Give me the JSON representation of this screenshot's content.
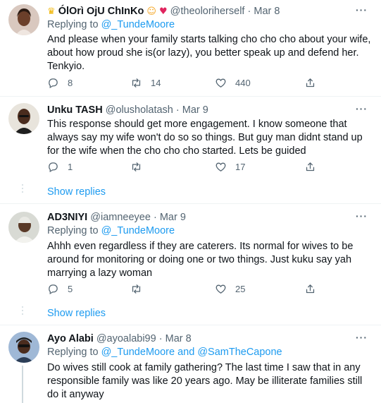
{
  "tweets": [
    {
      "name": "ÓlOrì OjU ChInKo",
      "emojis": [
        "crown-emoji",
        "smiling-face-with-hearts-emoji",
        "heart-emoji"
      ],
      "handle": "@theoloriherself",
      "dot": "·",
      "time": "Mar 8",
      "replying_prefix": "Replying to",
      "replying_to": [
        "@_TundeMoore"
      ],
      "text": "And please when your family starts talking cho cho cho about your wife, about how proud she is(or lazy), you better speak up and defend her. Tenkyio.",
      "replies": "8",
      "retweets": "14",
      "likes": "440"
    },
    {
      "name": "Unku TASH",
      "handle": "@olusholatash",
      "dot": "·",
      "time": "Mar 9",
      "text": "This response should get more engagement. I know someone that always say my wife won't do so so things. But guy man didnt stand up for the wife when the cho cho cho started. Lets be guided",
      "replies": "1",
      "retweets": "",
      "likes": "17",
      "show_replies": "Show replies"
    },
    {
      "name": "AD3NIYI",
      "handle": "@iamneeyee",
      "dot": "·",
      "time": "Mar 9",
      "replying_prefix": "Replying to",
      "replying_to": [
        "@_TundeMoore"
      ],
      "text": "Ahhh even regardless if they are caterers. Its normal for wives to be around for monitoring or doing one or two things. Just kuku say yah marrying a lazy woman",
      "replies": "5",
      "retweets": "",
      "likes": "25",
      "show_replies": "Show replies"
    },
    {
      "name": "Ayo Alabi",
      "handle": "@ayoalabi99",
      "dot": "·",
      "time": "Mar 8",
      "replying_prefix": "Replying to",
      "replying_to": [
        "@_TundeMoore",
        "@SamTheCapone"
      ],
      "replying_joiner": "and",
      "text": "Do wives still cook at family gathering? The last time I saw that in any responsible family was like 20 years ago. May be illiterate families still do it anyway"
    }
  ],
  "more_glyph": "···",
  "colors": {
    "link": "#1d9bf0",
    "muted": "#536471",
    "text": "#0f1419",
    "divider": "#eff3f4"
  }
}
